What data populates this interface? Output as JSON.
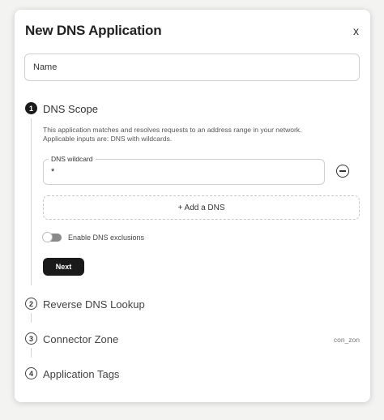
{
  "dialog": {
    "title": "New DNS Application",
    "close_label": "x",
    "name_placeholder": "Name"
  },
  "steps": [
    {
      "number": "1",
      "title": "DNS Scope"
    },
    {
      "number": "2",
      "title": "Reverse DNS Lookup"
    },
    {
      "number": "3",
      "title": "Connector Zone",
      "value": "con_zon"
    },
    {
      "number": "4",
      "title": "Application Tags"
    }
  ],
  "dns_scope": {
    "description": "This application matches and resolves requests to an address range in your network. Applicable inputs are: DNS with wildcards.",
    "wildcard_label": "DNS wildcard",
    "wildcard_value": "*",
    "add_dns_label": "+ Add a DNS",
    "exclusions_label": "Enable DNS exclusions",
    "exclusions_enabled": false,
    "next_label": "Next"
  },
  "icons": {
    "remove": "minus-circle-icon"
  }
}
